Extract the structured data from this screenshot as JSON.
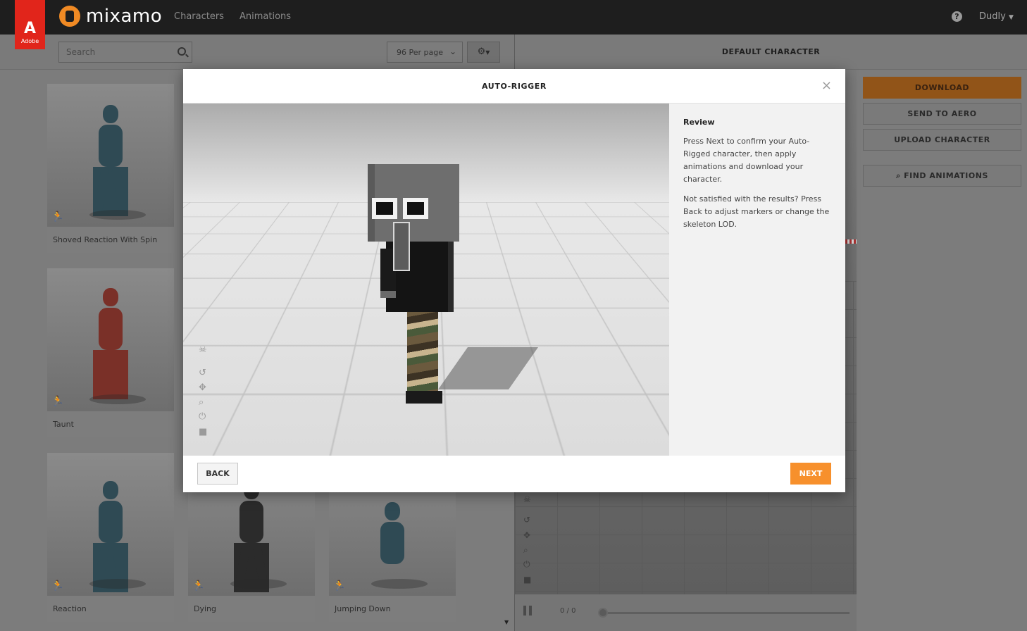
{
  "topbar": {
    "adobe_word": "Adobe",
    "brand_name": "mixamo",
    "nav": [
      "Characters",
      "Animations"
    ],
    "help_label": "?",
    "user_name": "Dudly"
  },
  "toolbar": {
    "search_placeholder": "Search",
    "per_page": "96 Per page"
  },
  "cards": [
    {
      "label": "Shoved Reaction With Spin"
    },
    {
      "label": "Taunt"
    },
    {
      "label": "Reaction"
    },
    {
      "label": "Dying"
    },
    {
      "label": "Jumping Down"
    }
  ],
  "viewer": {
    "title": "DEFAULT CHARACTER",
    "frame_count": "0 / 0"
  },
  "right_panel": {
    "download": "DOWNLOAD",
    "send_to_aero": "SEND TO AERO",
    "upload_character": "UPLOAD CHARACTER",
    "find_animations": "FIND ANIMATIONS"
  },
  "modal": {
    "title": "AUTO-RIGGER",
    "close": "×",
    "review_title": "Review",
    "review_p1": "Press Next to confirm your Auto-Rigged character, then apply animations and download your character.",
    "review_p2": "Not satisfied with the results? Press Back to adjust markers or change the skeleton LOD.",
    "back": "BACK",
    "next": "NEXT"
  },
  "colors": {
    "accent": "#f7902c",
    "adobe_red": "#e1251b",
    "topbar": "#1e1e1e"
  }
}
